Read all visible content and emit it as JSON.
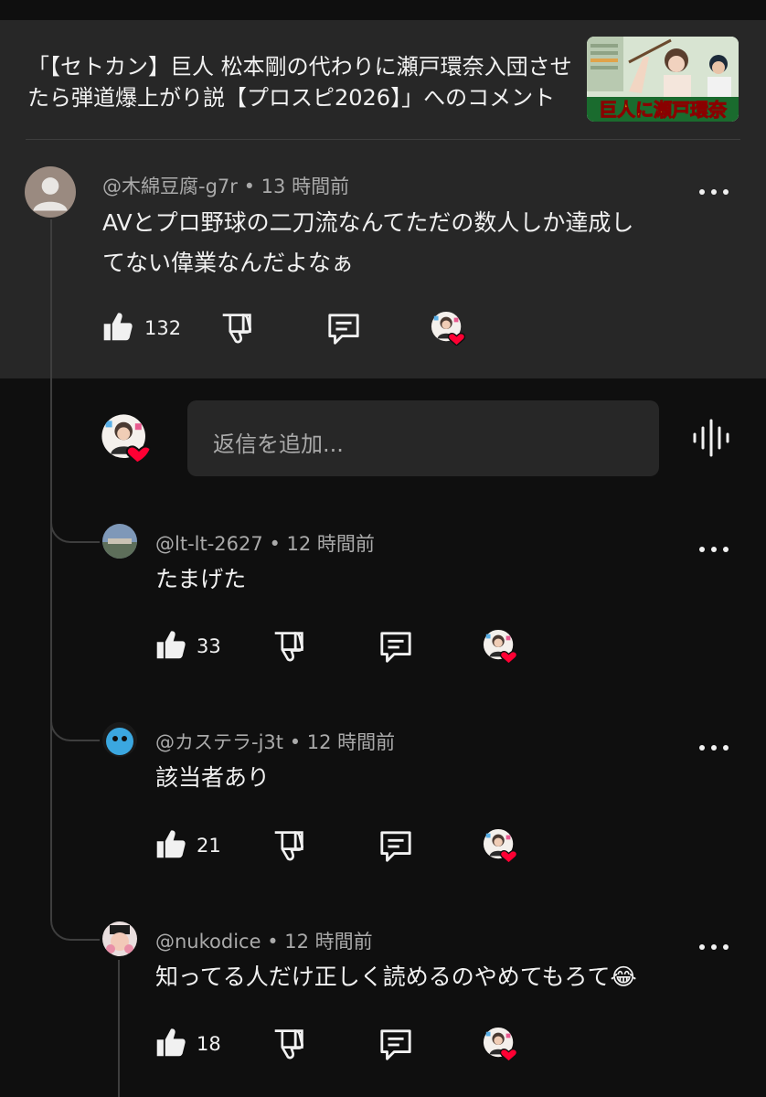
{
  "video": {
    "title_line1": "「【セトカン】巨人 松本剛の代わりに瀬戸環奈入団させ",
    "title_line2": "たら弾道爆上がり説【プロスピ2026】」へのコメント",
    "thumbnail_caption": "巨人に瀬戸環奈"
  },
  "comment": {
    "author": "@木綿豆腐-g7r",
    "time": "13 時間前",
    "text_line1": "AVとプロ野球の二刀流なんてただの数人しか達成し",
    "text_line2": "てない偉業なんだよなぁ",
    "likes": "132"
  },
  "reply_input": {
    "placeholder": "返信を追加..."
  },
  "replies": [
    {
      "author": "@lt-lt-2627",
      "time": "12 時間前",
      "text": "たまげた",
      "likes": "33"
    },
    {
      "author": "@カステラ-j3t",
      "time": "12 時間前",
      "text": "該当者あり",
      "likes": "21"
    },
    {
      "author": "@nukodice",
      "time": "12 時間前",
      "text": "知ってる人だけ正しく読めるのやめてもろて😂",
      "likes": "18"
    }
  ],
  "separator": "•",
  "icons": [
    "like-icon",
    "dislike-icon",
    "reply-icon",
    "creator-heart-icon",
    "more-icon",
    "mic-icon",
    "person-icon"
  ],
  "colors": {
    "background": "#0f0f0f",
    "highlight": "#272727",
    "secondary_text": "#aaaaaa",
    "heart": "#ff0033"
  }
}
